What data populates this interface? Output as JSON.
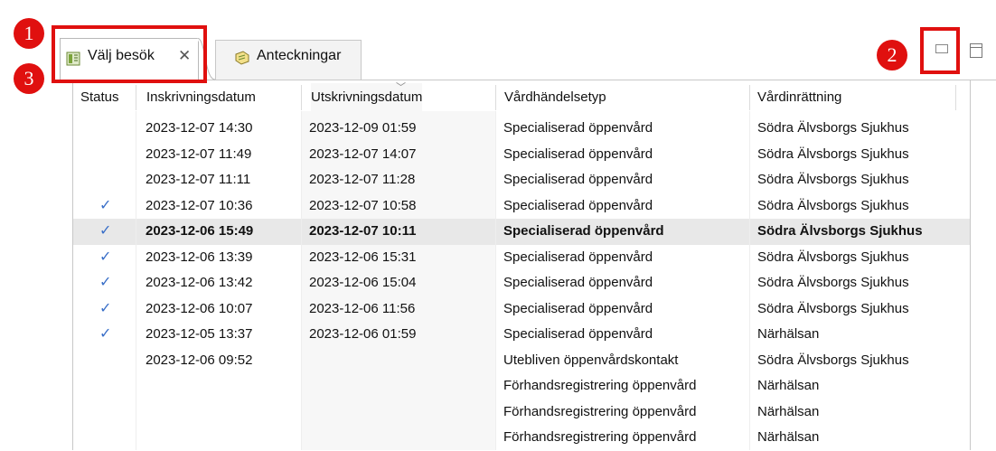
{
  "tabs": [
    {
      "label": "Välj besök",
      "icon": "visit-list-icon",
      "closable": true,
      "active": true
    },
    {
      "label": "Anteckningar",
      "icon": "notes-icon",
      "closable": false,
      "active": false
    }
  ],
  "window_controls": {
    "minimize_icon": "minimize-icon",
    "maximize_icon": "maximize-icon"
  },
  "annotations": [
    "1",
    "2",
    "3"
  ],
  "annotation_color": "#e0100f",
  "check_color": "#3a6fc8",
  "table": {
    "columns": [
      "Status",
      "Inskrivningsdatum",
      "Utskrivningsdatum",
      "Vårdhändelsetyp",
      "Vårdinrättning"
    ],
    "sorted_column": "Utskrivningsdatum",
    "selected_row": 4,
    "rows": [
      {
        "status": "",
        "in": "2023-12-07 14:30",
        "out": "2023-12-09 01:59",
        "type": "Specialiserad öppenvård",
        "unit": "Södra Älvsborgs Sjukhus"
      },
      {
        "status": "",
        "in": "2023-12-07 11:49",
        "out": "2023-12-07 14:07",
        "type": "Specialiserad öppenvård",
        "unit": "Södra Älvsborgs Sjukhus"
      },
      {
        "status": "",
        "in": "2023-12-07 11:11",
        "out": "2023-12-07 11:28",
        "type": "Specialiserad öppenvård",
        "unit": "Södra Älvsborgs Sjukhus"
      },
      {
        "status": "✓",
        "in": "2023-12-07 10:36",
        "out": "2023-12-07 10:58",
        "type": "Specialiserad öppenvård",
        "unit": "Södra Älvsborgs Sjukhus"
      },
      {
        "status": "✓",
        "in": "2023-12-06 15:49",
        "out": "2023-12-07 10:11",
        "type": "Specialiserad öppenvård",
        "unit": "Södra Älvsborgs Sjukhus"
      },
      {
        "status": "✓",
        "in": "2023-12-06 13:39",
        "out": "2023-12-06 15:31",
        "type": "Specialiserad öppenvård",
        "unit": "Södra Älvsborgs Sjukhus"
      },
      {
        "status": "✓",
        "in": "2023-12-06 13:42",
        "out": "2023-12-06 15:04",
        "type": "Specialiserad öppenvård",
        "unit": "Södra Älvsborgs Sjukhus"
      },
      {
        "status": "✓",
        "in": "2023-12-06 10:07",
        "out": "2023-12-06 11:56",
        "type": "Specialiserad öppenvård",
        "unit": "Södra Älvsborgs Sjukhus"
      },
      {
        "status": "✓",
        "in": "2023-12-05 13:37",
        "out": "2023-12-06 01:59",
        "type": "Specialiserad öppenvård",
        "unit": "Närhälsan"
      },
      {
        "status": "",
        "in": "2023-12-06 09:52",
        "out": "",
        "type": "Utebliven öppenvårdskontakt",
        "unit": "Södra Älvsborgs Sjukhus"
      },
      {
        "status": "",
        "in": "",
        "out": "",
        "type": "Förhandsregistrering öppenvård",
        "unit": "Närhälsan"
      },
      {
        "status": "",
        "in": "",
        "out": "",
        "type": "Förhandsregistrering öppenvård",
        "unit": "Närhälsan"
      },
      {
        "status": "",
        "in": "",
        "out": "",
        "type": "Förhandsregistrering öppenvård",
        "unit": "Närhälsan"
      }
    ]
  }
}
